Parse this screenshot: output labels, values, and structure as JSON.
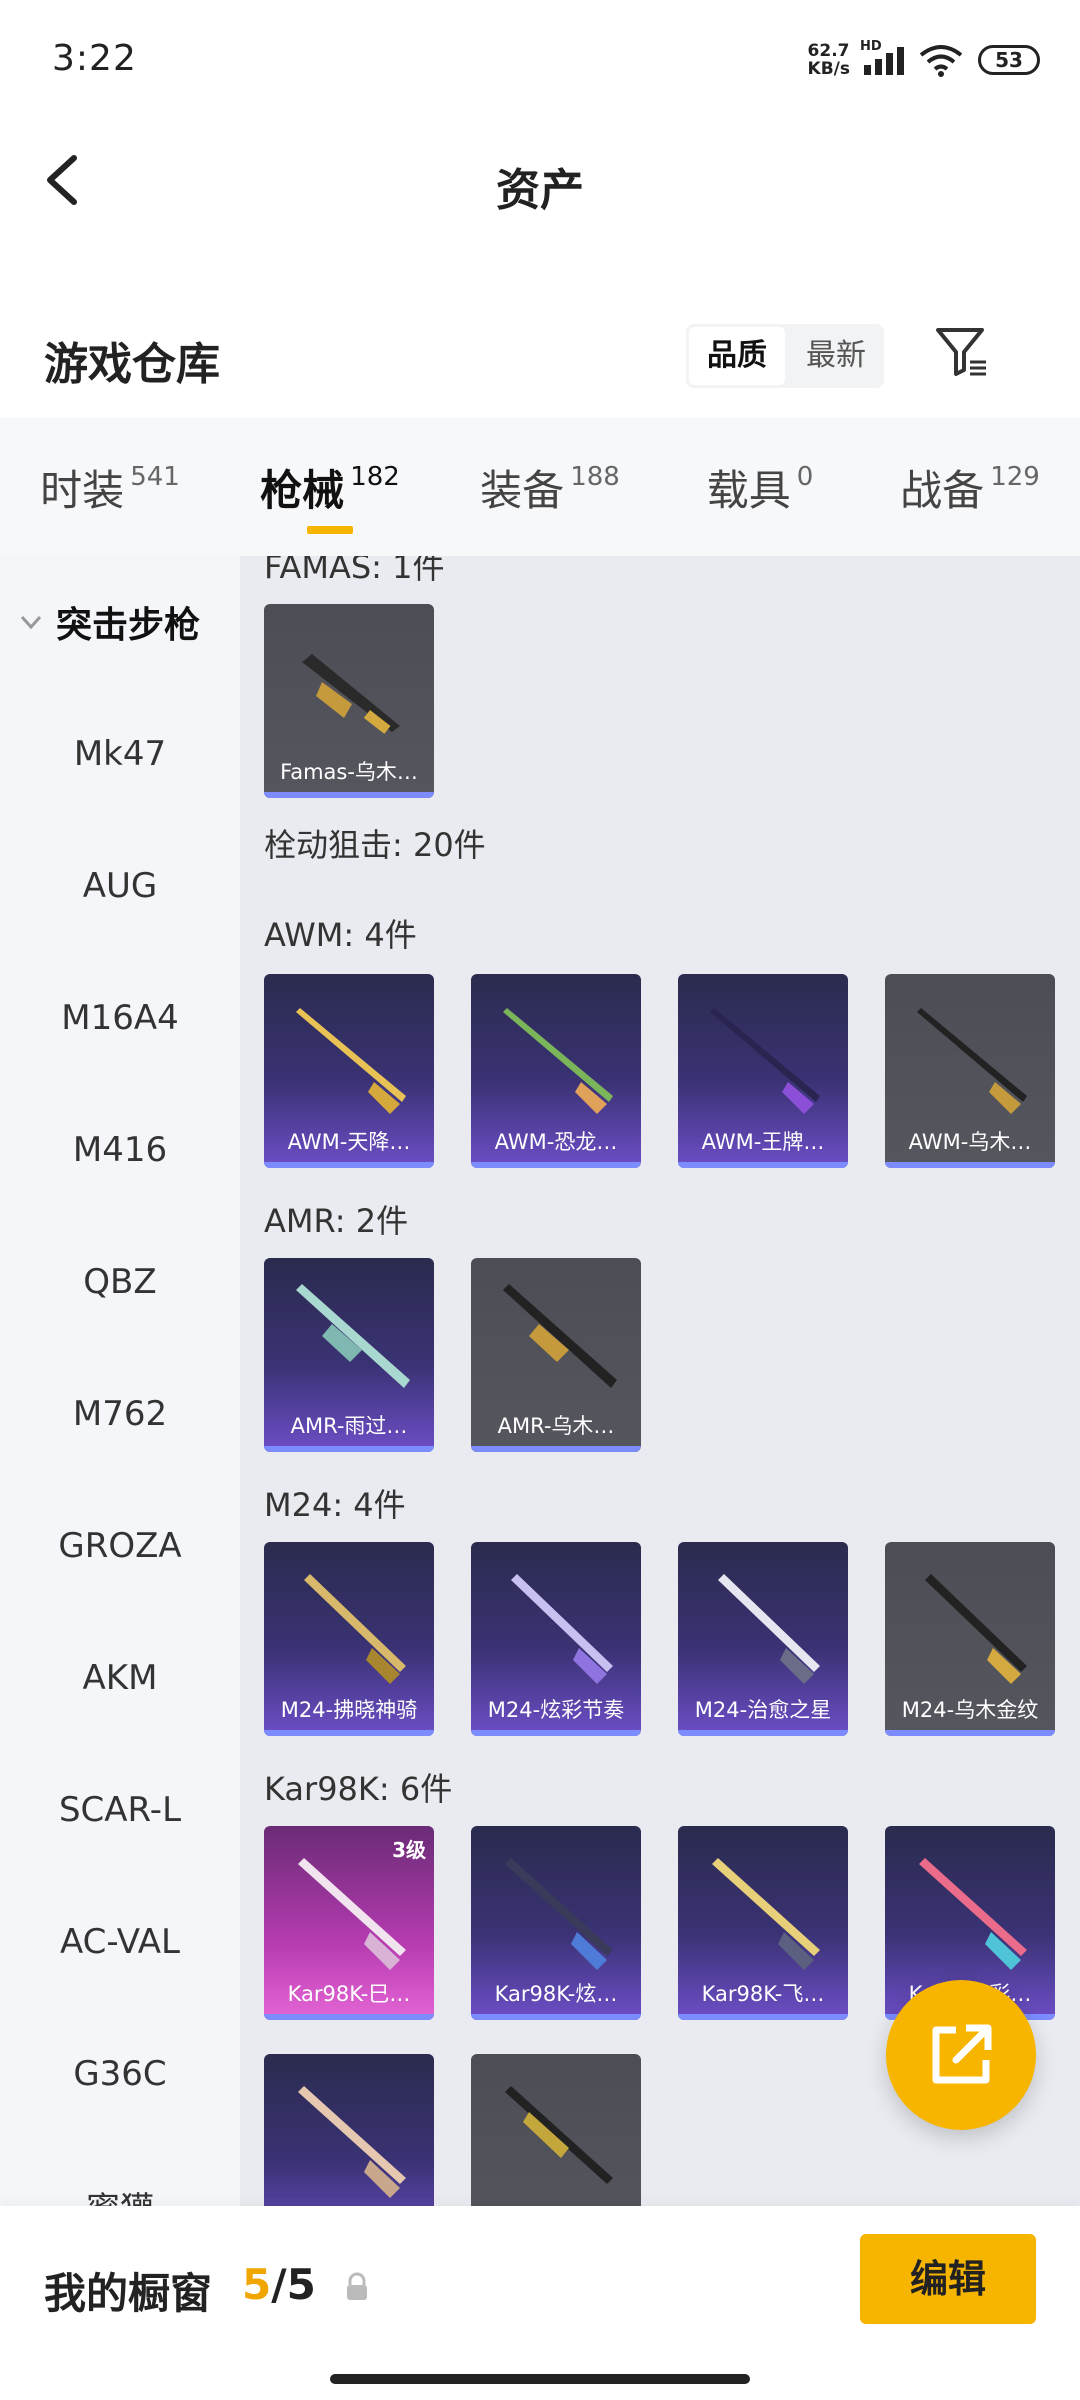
{
  "status": {
    "time": "3:22",
    "speed_value": "62.7",
    "speed_unit": "KB/s",
    "network": "HD",
    "battery": "53"
  },
  "header": {
    "title": "资产"
  },
  "section": {
    "title": "游戏仓库",
    "sort_options": [
      "品质",
      "最新"
    ]
  },
  "tabs": [
    {
      "label": "时装",
      "count": "541"
    },
    {
      "label": "枪械",
      "count": "182"
    },
    {
      "label": "装备",
      "count": "188"
    },
    {
      "label": "载具",
      "count": "0"
    },
    {
      "label": "战备",
      "count": "129"
    }
  ],
  "sidenav": {
    "group": "突击步枪",
    "items": [
      "Mk47",
      "AUG",
      "M16A4",
      "M416",
      "QBZ",
      "M762",
      "GROZA",
      "AKM",
      "SCAR-L",
      "AC-VAL",
      "G36C",
      "蜜獾"
    ]
  },
  "content": {
    "famas_header": "FAMAS: 1件",
    "famas_card": "Famas-乌木…",
    "sniper_header": "栓动狙击: 20件",
    "awm_header": "AWM: 4件",
    "awm_cards": [
      "AWM-天降…",
      "AWM-恐龙…",
      "AWM-王牌…",
      "AWM-乌木…"
    ],
    "amr_header": "AMR: 2件",
    "amr_cards": [
      "AMR-雨过…",
      "AMR-乌木…"
    ],
    "m24_header": "M24: 4件",
    "m24_cards": [
      "M24-拂晓神骑",
      "M24-炫彩节奏",
      "M24-治愈之星",
      "M24-乌木金纹"
    ],
    "kar_header": "Kar98K: 6件",
    "kar_cards": [
      "Kar98K-巳…",
      "Kar98K-炫…",
      "Kar98K-飞…",
      "Kar98K-彩…"
    ],
    "kar_badge": "3级"
  },
  "bottom": {
    "label": "我的橱窗",
    "current": "5",
    "total": "/5",
    "edit": "编辑"
  },
  "colors": {
    "accent": "#f7b500"
  }
}
